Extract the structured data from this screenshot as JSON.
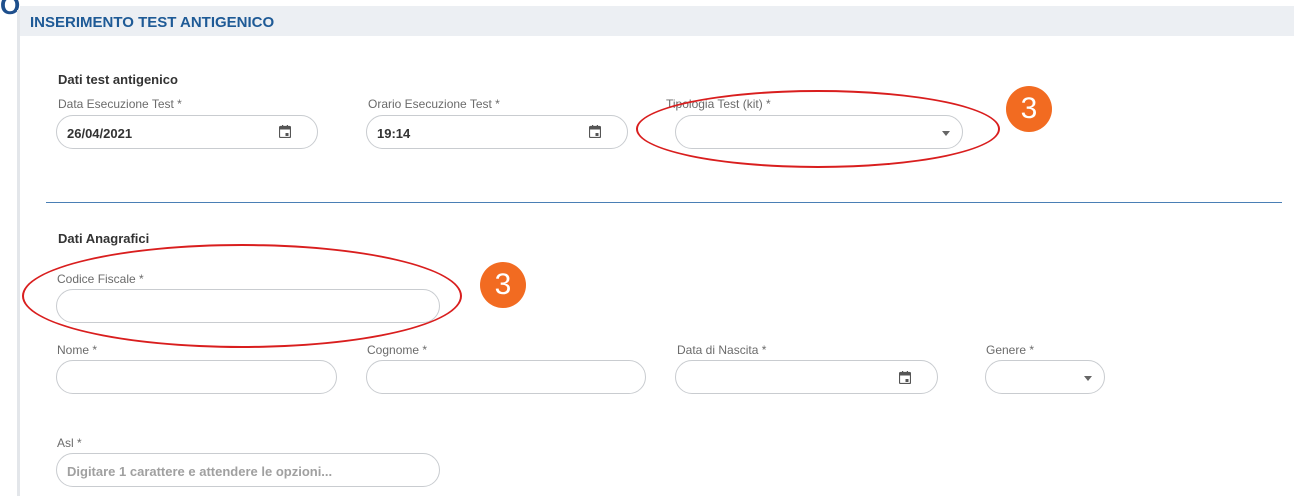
{
  "page": {
    "title": "INSERIMENTO TEST ANTIGENICO",
    "corner_fragment": "O"
  },
  "test_section": {
    "title": "Dati test antigenico",
    "date_label": "Data Esecuzione Test *",
    "date_value": "26/04/2021",
    "time_label": "Orario Esecuzione Test *",
    "time_value": "19:14",
    "kit_label": "Tipologia Test (kit) *",
    "kit_value": ""
  },
  "anagrafica_section": {
    "title": "Dati Anagrafici",
    "codice_fiscale_label": "Codice Fiscale *",
    "codice_fiscale_value": "",
    "nome_label": "Nome *",
    "cognome_label": "Cognome *",
    "data_nascita_label": "Data di Nascita *",
    "genere_label": "Genere *",
    "asl_label": "Asl *",
    "asl_placeholder": "Digitare 1 carattere e attendere le opzioni..."
  },
  "annotations": {
    "badge_1": "3",
    "badge_2": "3",
    "ellipse_color": "#d91e1e",
    "badge_color": "#f26b21"
  },
  "icons": [
    "calendar-icon",
    "chevron-down-icon"
  ]
}
